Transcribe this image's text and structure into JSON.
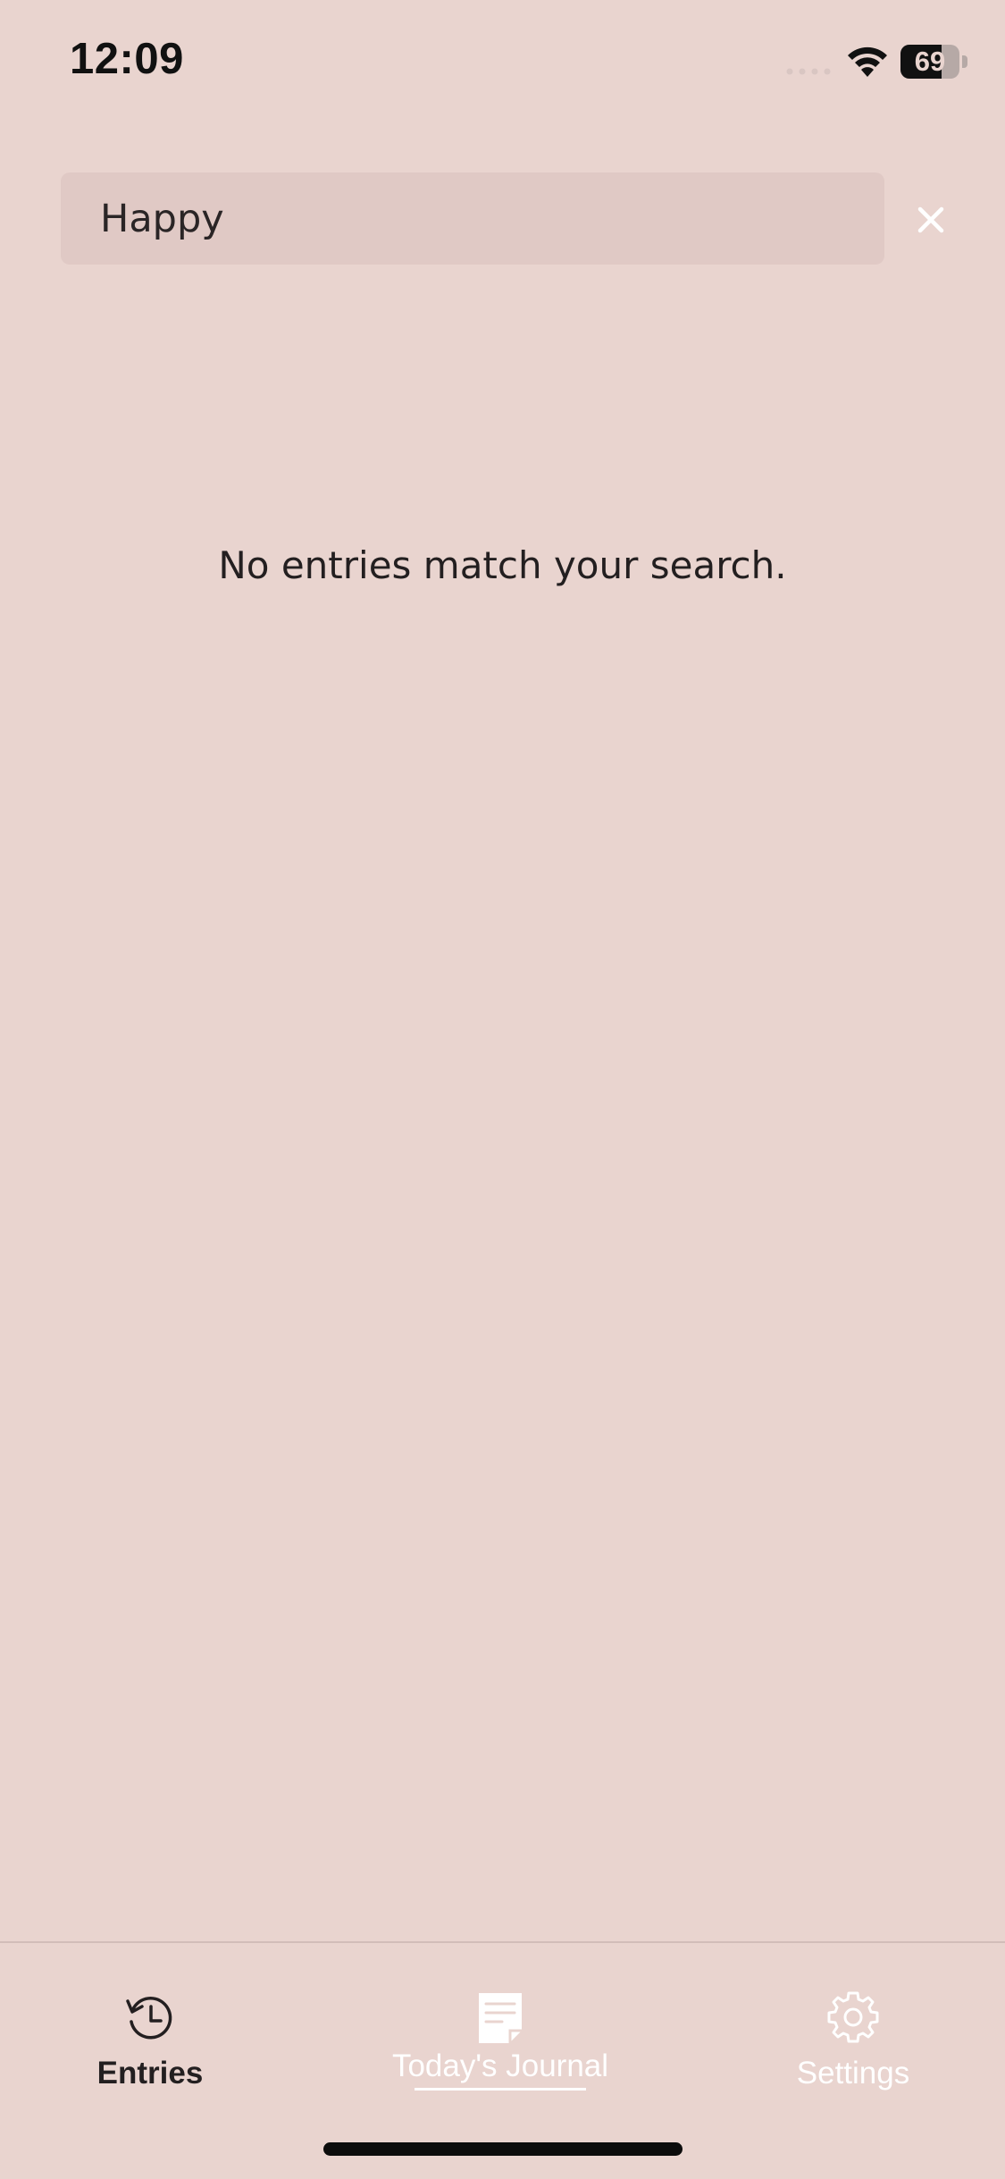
{
  "status_bar": {
    "time": "12:09",
    "battery_level": "69",
    "battery_fraction": 0.69
  },
  "search": {
    "query": "Happy",
    "clear_icon": "close-icon"
  },
  "empty_state": {
    "message": "No entries match your search."
  },
  "tab_bar": {
    "tabs": [
      {
        "label": "Entries",
        "icon": "history-icon",
        "state": "selected"
      },
      {
        "label": "Today's Journal",
        "icon": "journal-note-icon",
        "state": "underlined"
      },
      {
        "label": "Settings",
        "icon": "gear-icon",
        "state": "normal"
      }
    ]
  },
  "colors": {
    "background": "#E9D4CF",
    "search_field": "#E0C9C5",
    "text_dark": "#231F20",
    "tab_inactive": "#FFFFFF"
  }
}
